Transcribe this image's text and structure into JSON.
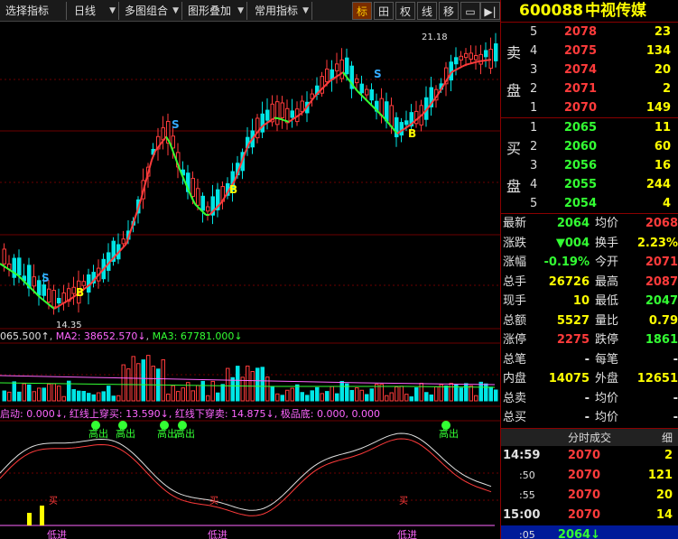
{
  "toolbar": {
    "select_indicator": "选择指标",
    "period": "日线",
    "multi_chart": "多图组合",
    "overlay": "图形叠加",
    "common_indicators": "常用指标",
    "icons": [
      "标",
      "田",
      "权",
      "线",
      "移",
      "▭",
      "▶|"
    ]
  },
  "chart": {
    "high_label": "21.18",
    "low_label": "14.35",
    "ma_text": {
      "ma1": "065.500↑",
      "ma2": "MA2: 38652.570↓",
      "ma3": "MA3: 67781.000↓"
    },
    "indicator_text": {
      "start": "启动: 0.000↓",
      "red_up": "红线上穿买: 13.590↓",
      "red_down": "红线下穿卖: 14.875↓",
      "extreme_low": "极品底: 0.000, 0.000"
    },
    "markers": {
      "high_out": "高出",
      "low_in": "低进",
      "buy": "B",
      "sell": "S",
      "buy_sign": "买"
    }
  },
  "stock": {
    "code": "600088",
    "name": "中视传媒"
  },
  "sell_side_label": [
    "卖",
    "盘"
  ],
  "buy_side_label": [
    "买",
    "盘"
  ],
  "asks": [
    {
      "level": "5",
      "price": "2078",
      "vol": "23"
    },
    {
      "level": "4",
      "price": "2075",
      "vol": "134"
    },
    {
      "level": "3",
      "price": "2074",
      "vol": "20"
    },
    {
      "level": "2",
      "price": "2071",
      "vol": "2"
    },
    {
      "level": "1",
      "price": "2070",
      "vol": "149"
    }
  ],
  "bids": [
    {
      "level": "1",
      "price": "2065",
      "vol": "11"
    },
    {
      "level": "2",
      "price": "2060",
      "vol": "60"
    },
    {
      "level": "3",
      "price": "2056",
      "vol": "16"
    },
    {
      "level": "4",
      "price": "2055",
      "vol": "244"
    },
    {
      "level": "5",
      "price": "2054",
      "vol": "4"
    }
  ],
  "stats": [
    {
      "l1": "最新",
      "v1": "2064",
      "c1": "green",
      "l2": "均价",
      "v2": "2068",
      "c2": "red"
    },
    {
      "l1": "涨跌",
      "v1": "▼004",
      "c1": "green",
      "l2": "换手",
      "v2": "2.23%",
      "c2": "yellow"
    },
    {
      "l1": "涨幅",
      "v1": "-0.19%",
      "c1": "green",
      "l2": "今开",
      "v2": "2071",
      "c2": "red"
    },
    {
      "l1": "总手",
      "v1": "26726",
      "c1": "yellow",
      "l2": "最高",
      "v2": "2087",
      "c2": "red"
    },
    {
      "l1": "现手",
      "v1": "10",
      "c1": "yellow",
      "l2": "最低",
      "v2": "2047",
      "c2": "green"
    },
    {
      "l1": "总额",
      "v1": "5527",
      "c1": "yellow",
      "l2": "量比",
      "v2": "0.79",
      "c2": "yellow"
    },
    {
      "l1": "涨停",
      "v1": "2275",
      "c1": "red",
      "l2": "跌停",
      "v2": "1861",
      "c2": "green"
    },
    {
      "l1": "总笔",
      "v1": "-",
      "c1": "white",
      "l2": "每笔",
      "v2": "-",
      "c2": "white"
    },
    {
      "l1": "内盘",
      "v1": "14075",
      "c1": "yellow",
      "l2": "外盘",
      "v2": "12651",
      "c2": "yellow"
    },
    {
      "l1": "总卖",
      "v1": "-",
      "c1": "white",
      "l2": "均价",
      "v2": "-",
      "c2": "white"
    },
    {
      "l1": "总买",
      "v1": "-",
      "c1": "white",
      "l2": "均价",
      "v2": "-",
      "c2": "white"
    }
  ],
  "ticks_title": "分时成交",
  "ticks_more": "细",
  "ticks": [
    {
      "time": "14:59",
      "price": "2070",
      "vol": "2",
      "pc": "red",
      "vc": "yellow",
      "bold_time": true
    },
    {
      "time": ":50",
      "price": "2070",
      "vol": "121",
      "pc": "red",
      "vc": "yellow",
      "bold_time": false
    },
    {
      "time": ":55",
      "price": "2070",
      "vol": "20",
      "pc": "red",
      "vc": "yellow",
      "bold_time": false
    },
    {
      "time": "15:00",
      "price": "2070",
      "vol": "14",
      "pc": "red",
      "vc": "yellow",
      "bold_time": true
    },
    {
      "time": ":05",
      "price": "2064↓",
      "vol": "",
      "pc": "green",
      "vc": "yellow",
      "bold_time": false
    }
  ],
  "colors": {
    "up": "#ff3b3b",
    "down": "#00e5e5",
    "ma_green": "#33ff33",
    "background": "#000000"
  }
}
